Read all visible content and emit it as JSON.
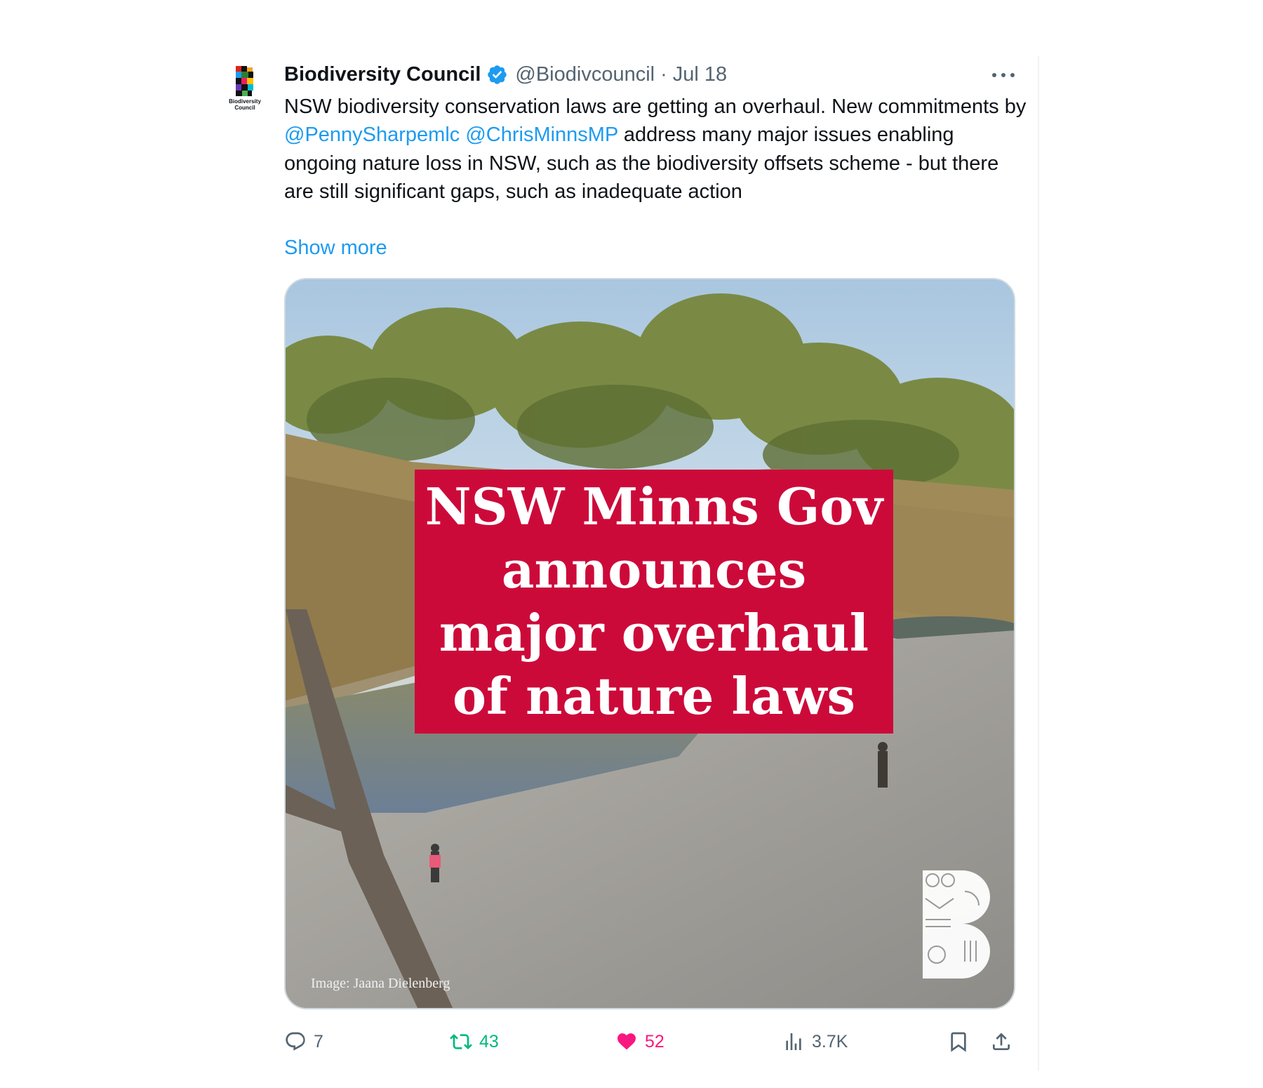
{
  "tweet": {
    "author_name": "Biodiversity Council",
    "handle": "@Biodivcouncil",
    "separator": "·",
    "date": "Jul 18",
    "avatar_caption": "Biodiversity Council",
    "text_part1": "NSW biodiversity conservation laws are getting an overhaul.  New commitments by ",
    "mention1": "@PennySharpemlc",
    "mention2": "@ChrisMinnsMP",
    "text_part2": " address many major issues enabling ongoing nature loss in NSW, such as the biodiversity offsets scheme - but there are still significant gaps, such as inadequate action",
    "show_more": "Show more"
  },
  "media": {
    "headline": "NSW Minns Gov announces major overhaul of nature laws",
    "credit": "Image: Jaana Dielenberg",
    "headline_color": "#cc0a3a"
  },
  "actions": {
    "reply_count": "7",
    "retweet_count": "43",
    "like_count": "52",
    "views_count": "3.7K"
  },
  "colors": {
    "link": "#1d9bf0",
    "secondary": "#536471",
    "retweet": "#00ba7c",
    "like": "#f91880"
  }
}
